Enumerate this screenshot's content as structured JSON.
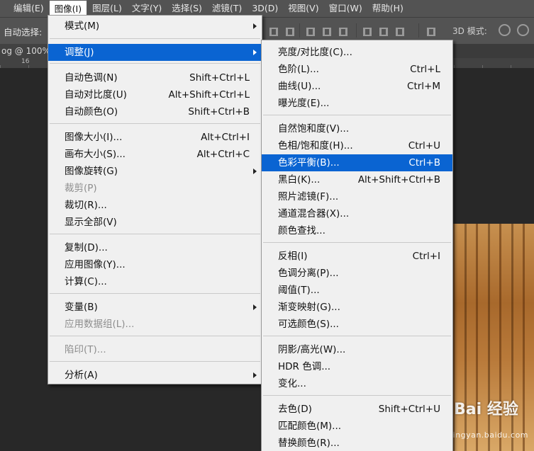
{
  "menubar": {
    "items": [
      "编辑(E)",
      "图像(I)",
      "图层(L)",
      "文字(Y)",
      "选择(S)",
      "滤镜(T)",
      "3D(D)",
      "视图(V)",
      "窗口(W)",
      "帮助(H)"
    ],
    "active_index": 1
  },
  "options_bar": {
    "auto_select_label": "自动选择:",
    "mode_3d_label": "3D 模式:"
  },
  "document": {
    "tab_label": "og @ 100% (",
    "ruler_number": "16"
  },
  "image_menu": {
    "items": [
      {
        "label": "模式(M)",
        "shortcut": "",
        "submenu": true,
        "disabled": false
      },
      {
        "label": "调整(J)",
        "shortcut": "",
        "submenu": true,
        "disabled": false
      },
      {
        "label": "自动色调(N)",
        "shortcut": "Shift+Ctrl+L",
        "submenu": false,
        "disabled": false
      },
      {
        "label": "自动对比度(U)",
        "shortcut": "Alt+Shift+Ctrl+L",
        "submenu": false,
        "disabled": false
      },
      {
        "label": "自动颜色(O)",
        "shortcut": "Shift+Ctrl+B",
        "submenu": false,
        "disabled": false
      },
      {
        "label": "图像大小(I)...",
        "shortcut": "Alt+Ctrl+I",
        "submenu": false,
        "disabled": false
      },
      {
        "label": "画布大小(S)...",
        "shortcut": "Alt+Ctrl+C",
        "submenu": false,
        "disabled": false
      },
      {
        "label": "图像旋转(G)",
        "shortcut": "",
        "submenu": true,
        "disabled": false
      },
      {
        "label": "裁剪(P)",
        "shortcut": "",
        "submenu": false,
        "disabled": true
      },
      {
        "label": "裁切(R)...",
        "shortcut": "",
        "submenu": false,
        "disabled": false
      },
      {
        "label": "显示全部(V)",
        "shortcut": "",
        "submenu": false,
        "disabled": false
      },
      {
        "label": "复制(D)...",
        "shortcut": "",
        "submenu": false,
        "disabled": false
      },
      {
        "label": "应用图像(Y)...",
        "shortcut": "",
        "submenu": false,
        "disabled": false
      },
      {
        "label": "计算(C)...",
        "shortcut": "",
        "submenu": false,
        "disabled": false
      },
      {
        "label": "变量(B)",
        "shortcut": "",
        "submenu": true,
        "disabled": false
      },
      {
        "label": "应用数据组(L)...",
        "shortcut": "",
        "submenu": false,
        "disabled": true
      },
      {
        "label": "陷印(T)...",
        "shortcut": "",
        "submenu": false,
        "disabled": true
      },
      {
        "label": "分析(A)",
        "shortcut": "",
        "submenu": true,
        "disabled": false
      }
    ],
    "highlighted_index": 1
  },
  "adjust_menu": {
    "items": [
      {
        "label": "亮度/对比度(C)...",
        "shortcut": ""
      },
      {
        "label": "色阶(L)...",
        "shortcut": "Ctrl+L"
      },
      {
        "label": "曲线(U)...",
        "shortcut": "Ctrl+M"
      },
      {
        "label": "曝光度(E)...",
        "shortcut": ""
      },
      {
        "label": "自然饱和度(V)...",
        "shortcut": ""
      },
      {
        "label": "色相/饱和度(H)...",
        "shortcut": "Ctrl+U"
      },
      {
        "label": "色彩平衡(B)...",
        "shortcut": "Ctrl+B"
      },
      {
        "label": "黑白(K)...",
        "shortcut": "Alt+Shift+Ctrl+B"
      },
      {
        "label": "照片滤镜(F)...",
        "shortcut": ""
      },
      {
        "label": "通道混合器(X)...",
        "shortcut": ""
      },
      {
        "label": "颜色查找...",
        "shortcut": ""
      },
      {
        "label": "反相(I)",
        "shortcut": "Ctrl+I"
      },
      {
        "label": "色调分离(P)...",
        "shortcut": ""
      },
      {
        "label": "阈值(T)...",
        "shortcut": ""
      },
      {
        "label": "渐变映射(G)...",
        "shortcut": ""
      },
      {
        "label": "可选颜色(S)...",
        "shortcut": ""
      },
      {
        "label": "阴影/高光(W)...",
        "shortcut": ""
      },
      {
        "label": "HDR 色调...",
        "shortcut": ""
      },
      {
        "label": "变化...",
        "shortcut": ""
      },
      {
        "label": "去色(D)",
        "shortcut": "Shift+Ctrl+U"
      },
      {
        "label": "匹配颜色(M)...",
        "shortcut": ""
      },
      {
        "label": "替换颜色(R)...",
        "shortcut": ""
      }
    ],
    "highlighted_index": 6
  },
  "watermark": {
    "logo_text": "Bai 经验",
    "url_text": "jingyan.baidu.com"
  },
  "colors": {
    "menu_highlight": "#0a64d2",
    "app_chrome": "#535353",
    "workspace": "#282828"
  }
}
